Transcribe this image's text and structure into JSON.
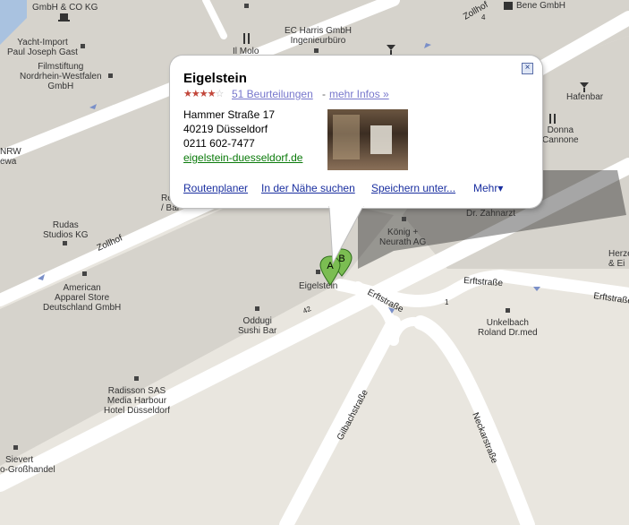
{
  "popup": {
    "title": "Eigelstein",
    "rating": 3.5,
    "reviews_link": "51 Beurteilungen",
    "separator": "-",
    "more_link": "mehr Infos »",
    "address_line1": "Hammer Straße 17",
    "address_line2": "40219 Düsseldorf",
    "phone": "0211 602-7477",
    "website": "eigelstein-duesseldorf.de",
    "actions": {
      "route": "Routenplaner",
      "nearby": "In der Nähe suchen",
      "save": "Speichern unter...",
      "more": "Mehr▾"
    },
    "close_glyph": "×"
  },
  "markers": {
    "a": "A",
    "b": "B"
  },
  "streets": {
    "zollhof_left": "Zollhof",
    "zollhof_top": "Zollhof",
    "erftstrasse_1": "Erftstraße",
    "erftstrasse_2": "Erftstraße",
    "erftstrasse_3": "Erftstraße",
    "gilbachstrasse": "Gilbachstraße",
    "neckarstrasse": "Neckarstraße",
    "road_number_42": "42",
    "road_number_4": "4",
    "road_number_1": "1"
  },
  "places": {
    "gmbh_co_kg": "GmbH & CO KG",
    "yacht_import": [
      "Yacht-Import",
      "Paul Joseph Gast"
    ],
    "filmstiftung": [
      "Filmstiftung",
      "Nordrhein-Westfalen",
      "GmbH"
    ],
    "nrw": [
      "NRW",
      "ewa"
    ],
    "il_molo": "Il Molo",
    "ec_harris": [
      "EC Harris GmbH",
      "Ingenieurbüro"
    ],
    "bene": "Bene GmbH",
    "hafenbar": "Hafenbar",
    "donna": [
      "Donna",
      "Cannone"
    ],
    "rudas": [
      "Rudas",
      "Studios KG"
    ],
    "american_apparel": [
      "American",
      "Apparel Store",
      "Deutschland GmbH"
    ],
    "eigelstein": "Eigelstein",
    "oddugi": [
      "Oddugi",
      "Sushi Bar"
    ],
    "koenig": [
      "König +",
      "Neurath AG"
    ],
    "zahnarzt": "Dr. Zahnarzt",
    "unkelbach": [
      "Unkelbach",
      "Roland Dr.med"
    ],
    "herzog": [
      "Herze",
      "& Ei"
    ],
    "radisson": [
      "Radisson SAS",
      "Media Harbour",
      "Hotel Düsseldorf"
    ],
    "sievert": [
      "Sievert",
      "o-Großhandel"
    ],
    "re_bar": [
      "Re",
      "/ Bar"
    ]
  },
  "colors": {
    "land": "#e9e6df",
    "block": "#d6d3cc",
    "road": "#ffffff",
    "water": "#a9c2e0",
    "marker": "#7bbd52",
    "link": "#1a2fa0",
    "website": "#0a7a0a"
  }
}
